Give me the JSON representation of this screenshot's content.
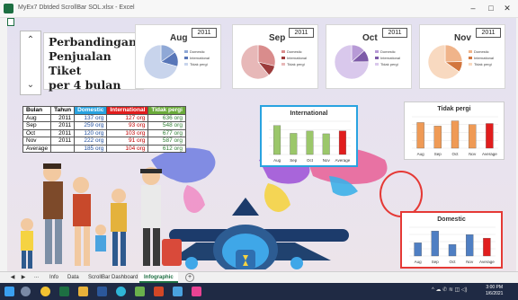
{
  "window": {
    "title": "MyEx7 Dbtded ScrollBar SOL.xlsx - Excel",
    "min_glyph": "–",
    "max_glyph": "□",
    "close_glyph": "✕"
  },
  "scroll": {
    "up_glyph": "⌃",
    "down_glyph": "⌄"
  },
  "title_lines": [
    "Perbandingan",
    "Penjualan Tiket",
    "per 4 bulan"
  ],
  "legend_labels": [
    "Domestic",
    "International",
    "Tidak pergi"
  ],
  "colors": {
    "domestic": "#5b8fd4",
    "international": "#2f5597",
    "tidak_pergi": "#a9c4e8",
    "bar_green": "#9bc76a",
    "bar_orange": "#ef9a55",
    "bar_blue": "#4f7fc3",
    "bar_red": "#e11d1d",
    "accent_blue": "#29a3e0",
    "accent_red": "#e53935"
  },
  "pies": [
    {
      "month": "Aug",
      "year": "2011",
      "colors": [
        "#8fa8d6",
        "#5876b8",
        "#c8d4ec"
      ],
      "values": [
        137,
        127,
        636
      ]
    },
    {
      "month": "Sep",
      "year": "2011",
      "colors": [
        "#d98c8c",
        "#9c3b3b",
        "#e7b8b8"
      ],
      "values": [
        259,
        93,
        548
      ]
    },
    {
      "month": "Oct",
      "year": "2011",
      "colors": [
        "#b79ad6",
        "#7d5aa8",
        "#d9c8ec"
      ],
      "values": [
        120,
        103,
        677
      ]
    },
    {
      "month": "Nov",
      "year": "2011",
      "colors": [
        "#f0b48a",
        "#d2763e",
        "#f8d9c0"
      ],
      "values": [
        222,
        91,
        587
      ]
    }
  ],
  "table": {
    "headers": [
      "Bulan",
      "Tahun",
      "Domestic",
      "International",
      "Tidak pergi"
    ],
    "rows": [
      [
        "Aug",
        "2011",
        "137 org",
        "127 org",
        "636 org"
      ],
      [
        "Sep",
        "2011",
        "259 org",
        "93 org",
        "548 org"
      ],
      [
        "Oct",
        "2011",
        "120 org",
        "103 org",
        "677 org"
      ],
      [
        "Nov",
        "2011",
        "222 org",
        "91 org",
        "587 org"
      ],
      [
        "Average",
        "",
        "185 org",
        "104 org",
        "612 org"
      ]
    ]
  },
  "chart_data": [
    {
      "type": "bar",
      "title": "International",
      "categories": [
        "Aug",
        "Sep",
        "Oct",
        "Nov",
        "Average"
      ],
      "values": [
        127,
        93,
        103,
        91,
        104
      ]
    },
    {
      "type": "bar",
      "title": "Tidak pergi",
      "categories": [
        "Aug",
        "Sep",
        "Oct",
        "Nov",
        "Average"
      ],
      "values": [
        636,
        548,
        677,
        587,
        612
      ]
    },
    {
      "type": "bar",
      "title": "Domestic",
      "categories": [
        "Aug",
        "Sep",
        "Oct",
        "Nov",
        "Average"
      ],
      "values": [
        137,
        259,
        120,
        222,
        185
      ]
    }
  ],
  "tabs": {
    "prev_glyph": "◀",
    "next_glyph": "▶",
    "ellipsis": "...",
    "items": [
      {
        "label": "Info",
        "active": false
      },
      {
        "label": "Data",
        "active": false
      },
      {
        "label": "ScrollBar Dashboard",
        "active": false
      },
      {
        "label": "Infographic",
        "active": true
      }
    ],
    "add_glyph": "+"
  },
  "taskbar": {
    "icons": [
      "start-icon",
      "search-icon",
      "chrome-icon",
      "excel-icon",
      "folder-icon",
      "word-icon",
      "edge-icon",
      "store-icon",
      "ppt-icon",
      "mail-icon",
      "app-icon"
    ],
    "tray": "^ ☁ ✆ ≋ ◫ ◁)",
    "time": "3:00 PM",
    "date": "1/6/2021"
  }
}
